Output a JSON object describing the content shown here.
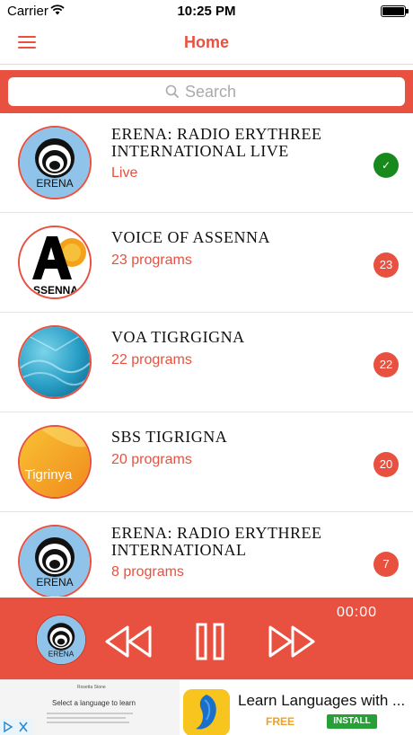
{
  "status_bar": {
    "carrier": "Carrier",
    "time": "10:25 PM"
  },
  "nav": {
    "title": "Home"
  },
  "search": {
    "placeholder": "Search"
  },
  "stations": [
    {
      "name": "ERENA: RADIO ERYTHREE INTERNATIONAL LIVE",
      "subtitle": "Live",
      "badge": "✓",
      "logo": "erena-logo"
    },
    {
      "name": "VOICE OF ASSENNA",
      "subtitle": "23 programs",
      "badge": "23",
      "logo": "assenna-logo"
    },
    {
      "name": "VOA TIGRGIGNA",
      "subtitle": "22 programs",
      "badge": "22",
      "logo": "voa-logo"
    },
    {
      "name": "SBS TIGRIGNA",
      "subtitle": "20 programs",
      "badge": "20",
      "logo": "sbs-tigrinya-logo"
    },
    {
      "name": "ERENA: RADIO ERYTHREE INTERNATIONAL",
      "subtitle": "8 programs",
      "badge": "7",
      "logo": "erena-logo"
    }
  ],
  "logo_text": {
    "erena": "ERENA",
    "assenna": "SSENNA",
    "sbs": "Tigrinya"
  },
  "player": {
    "elapsed": "00:00"
  },
  "ad": {
    "brand": "Rosetta Stone",
    "tagline": "Select a language to learn",
    "headline": "Learn Languages with ...",
    "price": "FREE",
    "install": "INSTALL"
  },
  "colors": {
    "accent": "#e8513f",
    "live": "#18891c"
  }
}
